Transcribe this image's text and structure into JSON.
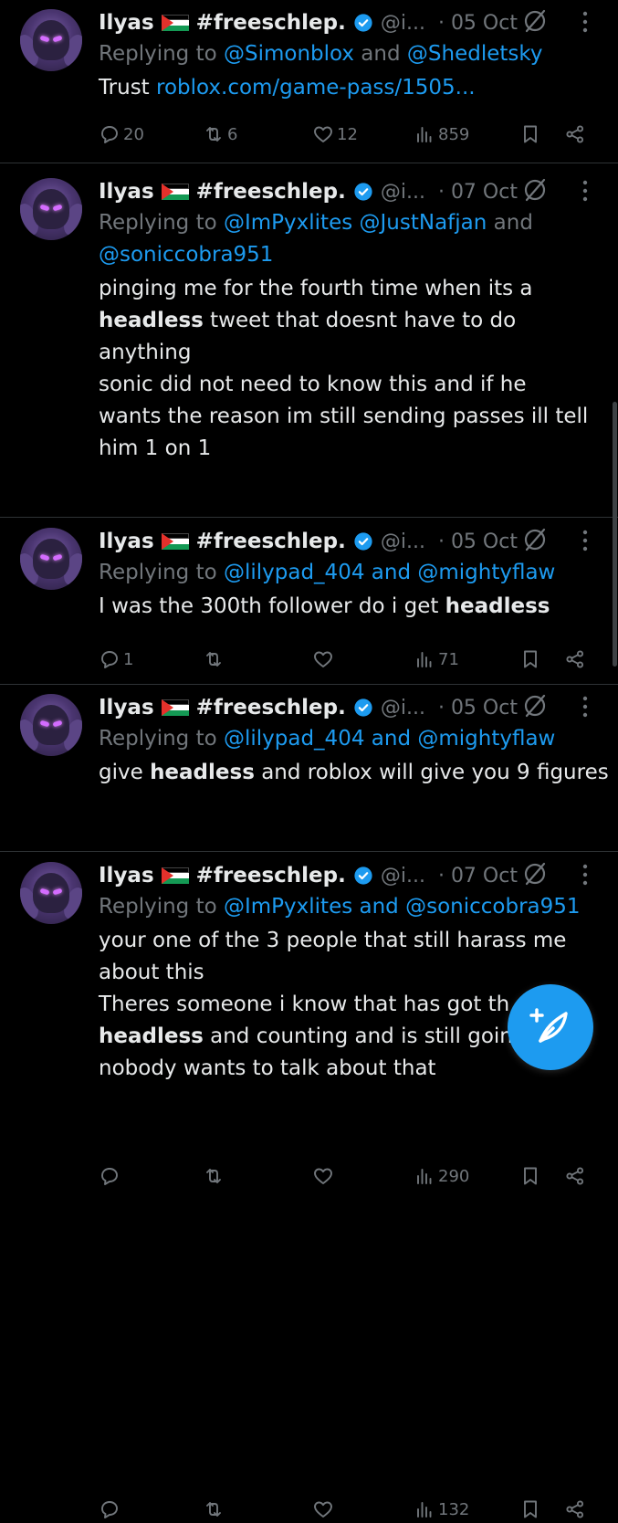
{
  "tweets": [
    {
      "name": "Ilyas",
      "hashtag": "#freeschlep.",
      "handle": "@i...",
      "date": "· 05 Oct",
      "reply_prefix": "Replying to ",
      "reply_lines": [
        [
          {
            "t": "@Simonblox",
            "link": true
          },
          {
            "t": " and ",
            "link": false
          },
          {
            "t": "@Shedletsky",
            "link": true
          }
        ]
      ],
      "body_lines": [
        [
          {
            "t": "Trust ",
            "b": false
          },
          {
            "t": "roblox.com/game-pass/1505...",
            "link": true
          }
        ]
      ],
      "stats": {
        "replies": "20",
        "reposts": "6",
        "likes": "12",
        "views": "859"
      }
    },
    {
      "name": "Ilyas",
      "hashtag": "#freeschlep.",
      "handle": "@i...",
      "date": "· 07 Oct",
      "reply_prefix": "Replying to ",
      "reply_lines": [
        [
          {
            "t": "@ImPyxlites",
            "link": true
          },
          {
            "t": " ",
            "link": false
          },
          {
            "t": "@JustNafjan",
            "link": true
          },
          {
            "t": " and",
            "link": false
          }
        ],
        [
          {
            "t": "@soniccobra951",
            "link": true
          }
        ]
      ],
      "body_lines": [
        [
          {
            "t": "pinging me for the fourth time when its a",
            "b": false
          }
        ],
        [
          {
            "t": "headless",
            "b": true
          },
          {
            "t": " tweet that doesnt have to do",
            "b": false
          }
        ],
        [
          {
            "t": "anything",
            "b": false
          }
        ],
        [
          {
            "t": "sonic did not need to know this and if he",
            "b": false
          }
        ],
        [
          {
            "t": "wants the reason im still sending passes ill tell",
            "b": false
          }
        ],
        [
          {
            "t": "him 1 on 1",
            "b": false
          }
        ]
      ],
      "stats": {
        "replies": "1",
        "reposts": "",
        "likes": "",
        "views": "71"
      }
    },
    {
      "name": "Ilyas",
      "hashtag": "#freeschlep.",
      "handle": "@i...",
      "date": "· 05 Oct",
      "reply_prefix": "Replying to ",
      "reply_lines": [
        [
          {
            "t": "@lilypad_404",
            "link": true
          },
          {
            "t": " and ",
            "link": true
          },
          {
            "t": "@mightyflaw",
            "link": true
          }
        ]
      ],
      "body_lines": [
        [
          {
            "t": "I was the 300th follower do i get ",
            "b": false
          },
          {
            "t": "headless",
            "b": true
          }
        ]
      ],
      "stats": {
        "replies": "",
        "reposts": "",
        "likes": "",
        "views": "290"
      }
    },
    {
      "name": "Ilyas",
      "hashtag": "#freeschlep.",
      "handle": "@i...",
      "date": "· 05 Oct",
      "reply_prefix": "Replying to ",
      "reply_lines": [
        [
          {
            "t": "@lilypad_404",
            "link": true
          },
          {
            "t": " and ",
            "link": true
          },
          {
            "t": "@mightyflaw",
            "link": true
          }
        ]
      ],
      "body_lines": [
        [
          {
            "t": "give ",
            "b": false
          },
          {
            "t": "headless",
            "b": true
          },
          {
            "t": " and roblox will give you 9 figures",
            "b": false
          }
        ]
      ],
      "stats": {
        "replies": "",
        "reposts": "",
        "likes": "",
        "views": "132"
      }
    },
    {
      "name": "Ilyas",
      "hashtag": "#freeschlep.",
      "handle": "@i...",
      "date": "· 07 Oct",
      "reply_prefix": "Replying to ",
      "reply_lines": [
        [
          {
            "t": "@ImPyxlites",
            "link": true
          },
          {
            "t": " and ",
            "link": true
          },
          {
            "t": "@soniccobra951",
            "link": true
          }
        ]
      ],
      "body_lines": [
        [
          {
            "t": "your one of the 3 people that still harass me",
            "b": false
          }
        ],
        [
          {
            "t": "about this",
            "b": false
          }
        ],
        [
          {
            "t": "Theres someone i know that has got th",
            "b": false
          }
        ],
        [
          {
            "t": "headless",
            "b": true
          },
          {
            "t": " and counting and is still goin",
            "b": false
          }
        ],
        [
          {
            "t": "nobody wants to talk about that",
            "b": false
          }
        ]
      ],
      "stats": null
    }
  ],
  "icons": {
    "reply": "reply-icon",
    "repost": "repost-icon",
    "like": "like-icon",
    "views": "views-icon",
    "bookmark": "bookmark-icon",
    "share": "share-icon",
    "grok": "grok-icon",
    "more": "more-icon",
    "verified": "verified-badge-icon",
    "compose": "compose-post-icon"
  },
  "colors": {
    "background": "#000000",
    "text": "#e7e9ea",
    "muted": "#71767b",
    "link": "#1d9bf0",
    "accent": "#1d9bf0"
  }
}
